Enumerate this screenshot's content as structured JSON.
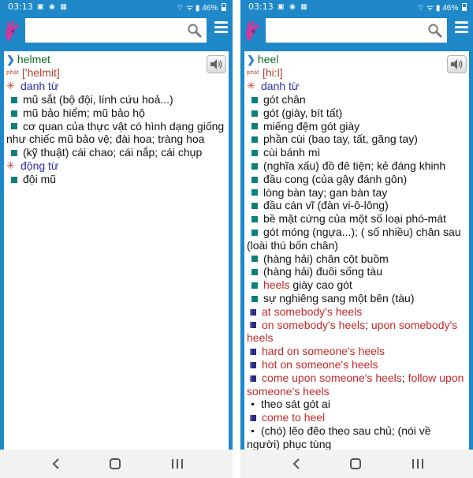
{
  "status_bar": {
    "time": "03:13",
    "left_icons": "▣ ◉ ▦",
    "right_icons": "⌔ ᯤ ▮",
    "battery": "46%"
  },
  "search": {
    "placeholder": ""
  },
  "colors": {
    "app_bar": "#1e88c9",
    "headword": "#0a6b21",
    "part_of_speech": "#2a32a7",
    "phonetic": "#b5412a",
    "idiom": "#c62828",
    "bullet": "#0e7f7a"
  },
  "icons": {
    "logo": "hand-logo-icon",
    "search": "magnifier-icon",
    "menu": "hamburger-menu-icon",
    "audio": "speaker-icon",
    "nav": [
      "back-icon",
      "home-icon",
      "recent-apps-icon"
    ]
  },
  "left_screen": {
    "headword": "helmet",
    "phonetic": "['helmit]",
    "phonetic_tag": "phát",
    "sections": [
      {
        "pos": "danh từ",
        "definitions": [
          "mũ sắt (bộ đội, lính cứu hoả...)",
          "mũ bảo hiểm; mũ bảo hộ",
          "cơ quan của thực vật có hình dạng giống như chiếc mũ bảo vệ; đài hoa; tràng hoa",
          "(kỹ thuật) cái chao; cái nắp; cái chụp"
        ]
      },
      {
        "pos": "động từ",
        "definitions": [
          "đội mũ"
        ]
      }
    ]
  },
  "right_screen": {
    "headword": "heel",
    "phonetic": "[hi:l]",
    "phonetic_tag": "phát",
    "pos": "danh từ",
    "definitions": [
      "gót chân",
      "gót (giày, bít tất)",
      "miếng đệm gót giày",
      "phần cùi (bao tay, tất, găng tay)",
      "cùi bánh mì",
      "(nghĩa xấu) đồ đê tiện; kẻ đáng khinh",
      "đầu cong (của gậy đánh gôn)",
      "lòng bàn tay; gan bàn tay",
      "đầu cán vĩ (đàn vi-ô-lông)",
      "bề mặt cứng của một số loại phó-mát",
      "gót móng (ngựa...); ( số nhiều) chân sau (loài thú bốn chân)",
      "(hàng hải) chân cột buồm",
      "(hàng hải) đuôi sống tàu"
    ],
    "heels_def": {
      "term": "heels",
      "text": " giày cao gót"
    },
    "last_def": "sự nghiêng sang một bên (tàu)",
    "idioms": {
      "i1": "at somebody's heels",
      "i2a": "on somebody's heels",
      "i2b": "upon somebody's heels",
      "i3": "hard on someone's heels",
      "i4": "hot on someone's heels",
      "i5a": "come upon someone's heels",
      "i5b": "follow upon someone's heels",
      "sep": "; "
    },
    "usage1": "theo sát gót ai",
    "idiom6": "come to heel",
    "usage2": "(chó) lẽo đẽo theo sau chủ; (nói về người) phục tùng"
  }
}
